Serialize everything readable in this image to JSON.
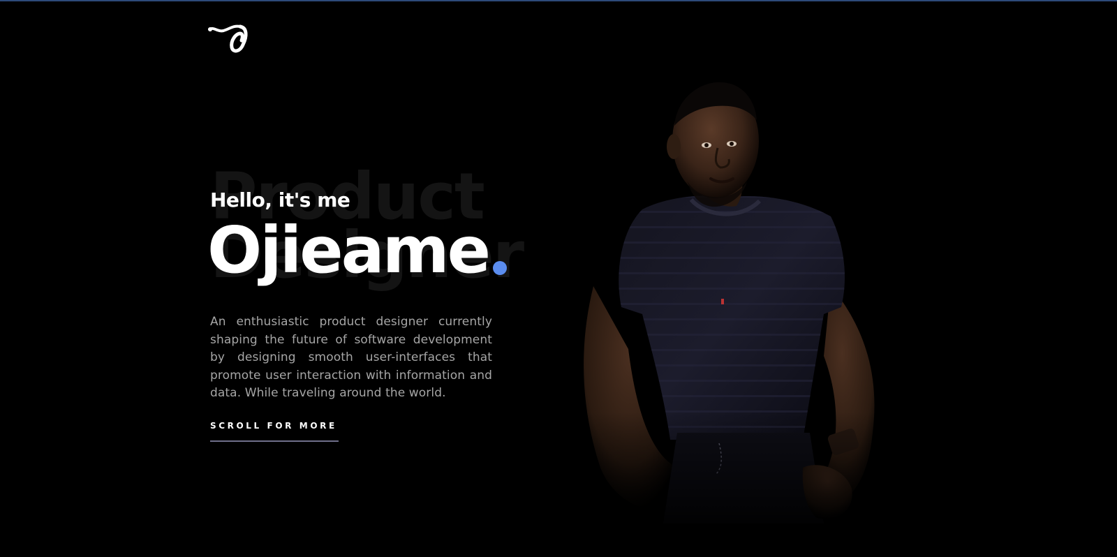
{
  "brand": {
    "logo_glyph": "o",
    "logo_icon": "script-o-logo-icon"
  },
  "hero": {
    "watermark_text": "Product\nDesigner",
    "greeting": "Hello, it's me",
    "name": "Ojieame",
    "bio": "An enthusiastic product designer currently shaping the future of software development by designing smooth user-interfaces that promote user interaction with information and data. While traveling around the world.",
    "scroll_cta": "SCROLL FOR MORE"
  },
  "portrait": {
    "image": "person-portrait-photo"
  },
  "colors": {
    "background": "#000000",
    "accent_dot": "#5b8def",
    "top_bar": "#2d4a7a",
    "text_primary": "#ffffff",
    "text_secondary": "#a6a6a6",
    "watermark": "#141414",
    "underline": "#6f6f8a"
  }
}
